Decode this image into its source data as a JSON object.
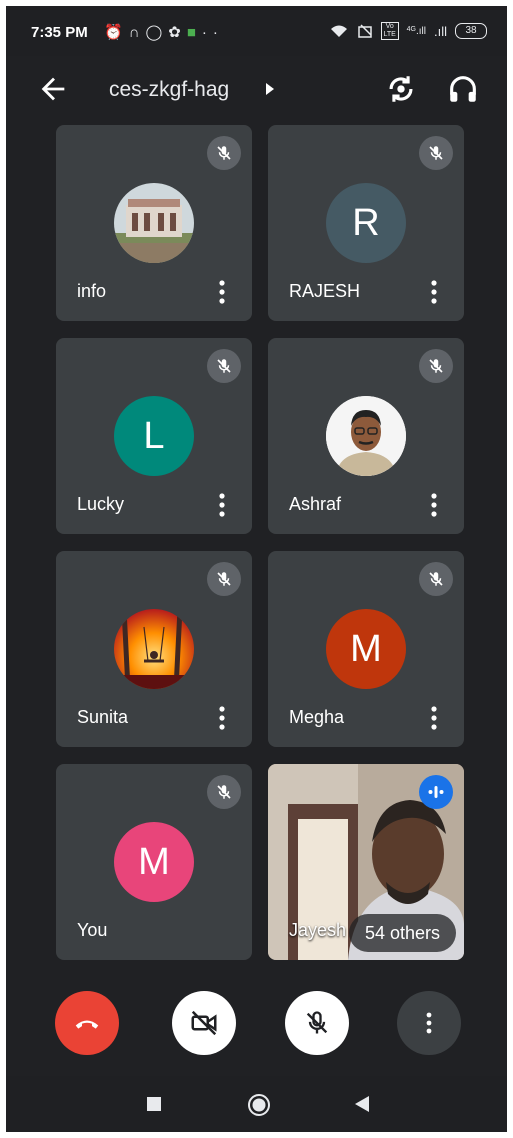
{
  "status_bar": {
    "time": "7:35 PM",
    "left_icons": [
      "alarm-icon",
      "headphones-icon",
      "whatsapp-icon",
      "settings-icon",
      "app-icon",
      "more-notifications-icon"
    ],
    "right_icons": [
      "wifi-icon",
      "data-icon",
      "volte-icon",
      "signal-4g-icon",
      "signal-icon"
    ],
    "network_label": "4G",
    "volte_label": "Vo LTE",
    "battery": "38"
  },
  "header": {
    "meeting_code": "ces-zkgf-hag",
    "icons": [
      "back-arrow-icon",
      "caret-right-icon",
      "switch-camera-icon",
      "headphones-icon"
    ]
  },
  "participants": [
    {
      "name": "info",
      "avatar_type": "photo",
      "avatar_desc": "building-photo",
      "muted": true
    },
    {
      "name": "RAJESH",
      "avatar_type": "initial",
      "initial": "R",
      "color": "#455a64",
      "muted": true
    },
    {
      "name": "Lucky",
      "avatar_type": "initial",
      "initial": "L",
      "color": "#00897b",
      "muted": true
    },
    {
      "name": "Ashraf",
      "avatar_type": "photo",
      "avatar_desc": "person-photo",
      "muted": true
    },
    {
      "name": "Sunita",
      "avatar_type": "photo",
      "avatar_desc": "autumn-swing-painting",
      "muted": true
    },
    {
      "name": "Megha",
      "avatar_type": "initial",
      "initial": "M",
      "color": "#bf360c",
      "muted": true
    },
    {
      "name": "You",
      "avatar_type": "initial",
      "initial": "M",
      "color": "#e8457a",
      "muted": true
    },
    {
      "name": "Jayesh",
      "avatar_type": "video",
      "speaking": true
    }
  ],
  "others_label": "54 others",
  "controls": {
    "end_call": {
      "icon": "end-call-icon",
      "color": "#ea4335"
    },
    "camera": {
      "icon": "camera-off-icon",
      "color": "#ffffff"
    },
    "mic": {
      "icon": "mic-off-icon",
      "color": "#ffffff"
    },
    "more": {
      "icon": "more-vert-icon",
      "color": "#3c4043"
    }
  },
  "nav_bar": {
    "icons": [
      "recents-square-icon",
      "home-circle-icon",
      "back-triangle-icon"
    ]
  },
  "colors": {
    "background": "#202124",
    "tile": "#3c4043",
    "mute_badge": "#5f6368",
    "speaking_badge": "#1a73e8"
  }
}
